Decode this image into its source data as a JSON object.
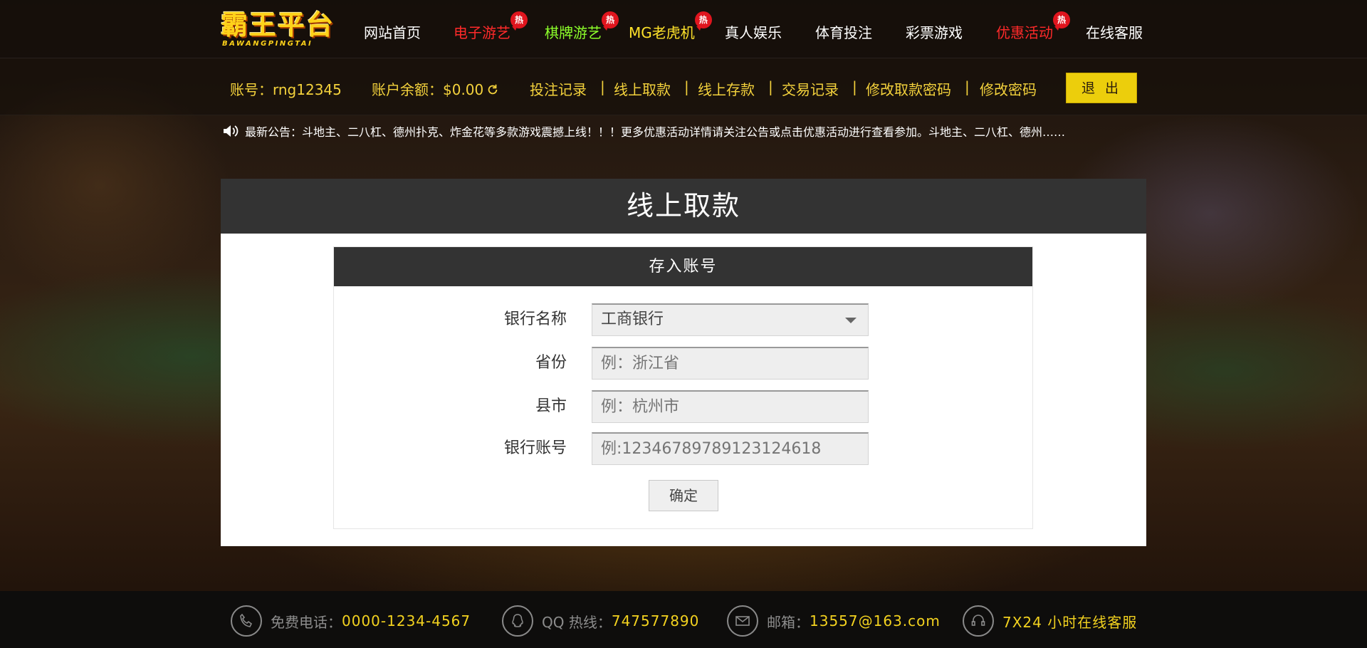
{
  "logo": {
    "main": "霸王平台",
    "sub": "BAWANGPINGTAI"
  },
  "nav": [
    {
      "label": "网站首页",
      "color": "#ffffff",
      "hot": false
    },
    {
      "label": "电子游艺",
      "color": "#ff2a2a",
      "hot": true
    },
    {
      "label": "棋牌游艺",
      "color": "#8cff2a",
      "hot": true
    },
    {
      "label": "MG老虎机",
      "color": "#ffe22a",
      "hot": true
    },
    {
      "label": "真人娱乐",
      "color": "#ffffff",
      "hot": false
    },
    {
      "label": "体育投注",
      "color": "#ffffff",
      "hot": false
    },
    {
      "label": "彩票游戏",
      "color": "#ffffff",
      "hot": false
    },
    {
      "label": "优惠活动",
      "color": "#ff2a2a",
      "hot": true
    },
    {
      "label": "在线客服",
      "color": "#ffffff",
      "hot": false
    }
  ],
  "hot_label": "热",
  "user": {
    "account_label": "账号：",
    "account": "rng12345",
    "balance_label": "账户余额：",
    "balance": "$0.00",
    "links": [
      "投注记录",
      "线上取款",
      "线上存款",
      "交易记录",
      "修改取款密码",
      "修改密码"
    ],
    "separator": "|",
    "logout": "退 出"
  },
  "notice": "最新公告：斗地主、二八杠、德州扑克、炸金花等多款游戏震撼上线！！！更多优惠活动详情请关注公告或点击优惠活动进行查看参加。斗地主、二八杠、德州……",
  "panel": {
    "title": "线上取款",
    "form_title": "存入账号",
    "fields": {
      "bank_name": {
        "label": "银行名称",
        "value": "工商银行"
      },
      "province": {
        "label": "省份",
        "placeholder": "例：浙江省"
      },
      "city": {
        "label": "县市",
        "placeholder": "例：杭州市"
      },
      "account": {
        "label": "银行账号",
        "placeholder": "例:1234678978912312461​8"
      }
    },
    "submit": "确定"
  },
  "footer": {
    "phone_label": "免费电话：",
    "phone": "0000-1234-4567",
    "qq_label": "QQ 热线：",
    "qq": "747577890",
    "email_label": "邮箱：",
    "email": "13557@163.com",
    "service": "7X24 小时在线客服"
  },
  "colors": {
    "accent": "#f4d23c",
    "logout_bg": "#ecce0c",
    "header_dark": "#333333"
  }
}
